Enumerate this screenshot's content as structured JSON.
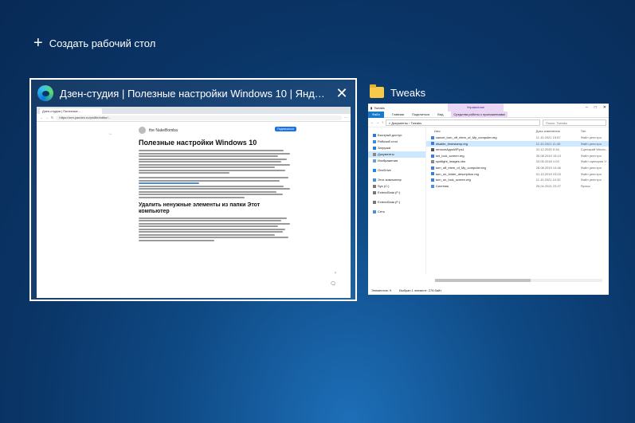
{
  "new_desktop": {
    "label": "Создать рабочий стол"
  },
  "windows": [
    {
      "app": "edge",
      "title": "Дзен-студия | Полезные настройки Windows 10 | Яндекс...",
      "tab_title": "Дзен-студия | Полезные...",
      "url": "https://zen.yandex.ru/profile/editor/...",
      "page": {
        "author": "the NakeBomba",
        "subscribe": "Подписаться",
        "h1": "Полезные настройки Windows 10",
        "h2": "Удалить ненужные элементы из папки Этот компьютер"
      }
    },
    {
      "app": "explorer",
      "title": "Tweaks",
      "window_title": "Tweaks",
      "manage_label": "Управление",
      "ribbon_tabs": [
        "Файл",
        "Главная",
        "Поделиться",
        "Вид"
      ],
      "ribbon_tools": "Средства работы с приложениями",
      "path": "« Документы › Tweaks",
      "search_placeholder": "Поиск: Tweaks",
      "columns": [
        "Имя",
        "Дата изменения",
        "Тип"
      ],
      "sidebar": [
        "Быстрый доступ",
        "Рабочий стол",
        "Загрузки",
        "Документы",
        "Изображения",
        "OneDrive",
        "Этот компьютер",
        "Sys (C:)",
        "ExtendData (F:)",
        "ExtendData (F:)",
        "Сеть"
      ],
      "files": [
        {
          "name": "cancel_turn_off_elem_of_My_computer.reg",
          "date": "11.10.2021 15:57",
          "type": "Файл реестра"
        },
        {
          "name": "disable_timestamp.reg",
          "date": "11.10.2021 11:45",
          "type": "Файл реестра"
        },
        {
          "name": "removeAppsWP.ps1",
          "date": "31.12.2020 0:34",
          "type": "Сценарий Windo..."
        },
        {
          "name": "set_lock_screen.reg",
          "date": "30.08.2019 15:13",
          "type": "Файл реестра"
        },
        {
          "name": "spotlight_images.vbs",
          "date": "03.05.2018 1:03",
          "type": "Файл сценария V..."
        },
        {
          "name": "turn_off_elem_of_My_computer.reg",
          "date": "28.08.2019 14:46",
          "type": "Файл реестра"
        },
        {
          "name": "turn_on_folder_description.reg",
          "date": "01.10.2019 23:03",
          "type": "Файл реестра"
        },
        {
          "name": "turn_on_lock_screen.reg",
          "date": "11.10.2021 10:32",
          "type": "Файл реестра"
        },
        {
          "name": "Система",
          "date": "25.04.2021 23:27",
          "type": "Ярлык"
        }
      ],
      "status": {
        "count": "Элементов: 9",
        "selected": "Выбран 1 элемент: 278 байт"
      }
    }
  ]
}
